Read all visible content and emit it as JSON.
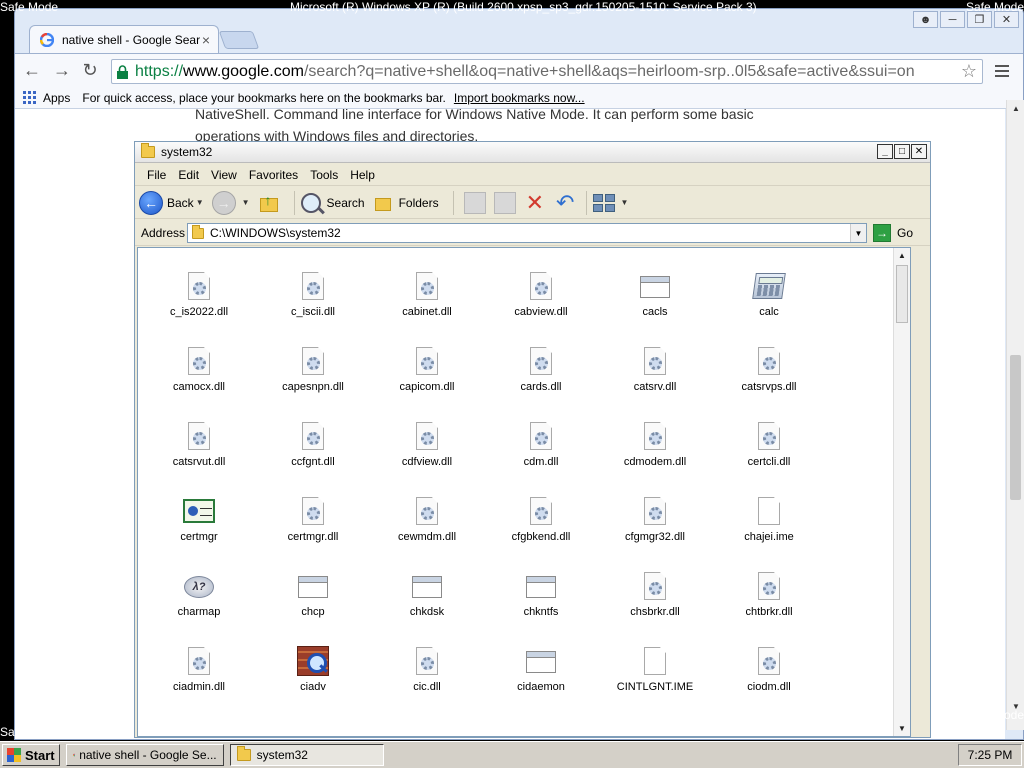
{
  "os": {
    "safe_mode_label": "Safe Mode",
    "top_title": "Microsoft (R) Windows XP (R) (Build 2600.xpsp_sp3_gdr.150205-1510: Service Pack 3)"
  },
  "chrome": {
    "tab_title": "native shell - Google Sear",
    "tab_close": "×",
    "url_scheme": "https://",
    "url_host": "www.google.com",
    "url_path": "/search?q=native+shell&oq=native+shell&aqs=heirloom-srp..0l5&safe=active&ssui=on",
    "bookmarks_apps": "Apps",
    "bookmarks_hint": "For quick access, place your bookmarks here on the bookmarks bar.",
    "bookmarks_import": "Import bookmarks now...",
    "page_text_line1": "NativeShell. Command line interface for Windows Native Mode. It can perform some basic",
    "page_text_line2": "operations with Windows files and directories."
  },
  "explorer": {
    "title": "system32",
    "menu": [
      "File",
      "Edit",
      "View",
      "Favorites",
      "Tools",
      "Help"
    ],
    "toolbar": {
      "back": "Back",
      "search": "Search",
      "folders": "Folders"
    },
    "address_label": "Address",
    "address_value": "C:\\WINDOWS\\system32",
    "go_label": "Go",
    "items": [
      {
        "name": "c_is2022.dll",
        "icon": "dll"
      },
      {
        "name": "c_iscii.dll",
        "icon": "dll"
      },
      {
        "name": "cabinet.dll",
        "icon": "dll"
      },
      {
        "name": "cabview.dll",
        "icon": "dll"
      },
      {
        "name": "cacls",
        "icon": "exe"
      },
      {
        "name": "calc",
        "icon": "calc"
      },
      {
        "name": "camocx.dll",
        "icon": "dll"
      },
      {
        "name": "capesnpn.dll",
        "icon": "dll"
      },
      {
        "name": "capicom.dll",
        "icon": "dll"
      },
      {
        "name": "cards.dll",
        "icon": "dll"
      },
      {
        "name": "catsrv.dll",
        "icon": "dll"
      },
      {
        "name": "catsrvps.dll",
        "icon": "dll"
      },
      {
        "name": "catsrvut.dll",
        "icon": "dll"
      },
      {
        "name": "ccfgnt.dll",
        "icon": "dll"
      },
      {
        "name": "cdfview.dll",
        "icon": "dll"
      },
      {
        "name": "cdm.dll",
        "icon": "dll"
      },
      {
        "name": "cdmodem.dll",
        "icon": "dll"
      },
      {
        "name": "certcli.dll",
        "icon": "dll"
      },
      {
        "name": "certmgr",
        "icon": "cert"
      },
      {
        "name": "certmgr.dll",
        "icon": "dll"
      },
      {
        "name": "cewmdm.dll",
        "icon": "dll"
      },
      {
        "name": "cfgbkend.dll",
        "icon": "dll"
      },
      {
        "name": "cfgmgr32.dll",
        "icon": "dll"
      },
      {
        "name": "chajei.ime",
        "icon": "blank"
      },
      {
        "name": "charmap",
        "icon": "charmap"
      },
      {
        "name": "chcp",
        "icon": "exe"
      },
      {
        "name": "chkdsk",
        "icon": "exe"
      },
      {
        "name": "chkntfs",
        "icon": "exe"
      },
      {
        "name": "chsbrkr.dll",
        "icon": "dll"
      },
      {
        "name": "chtbrkr.dll",
        "icon": "dll"
      },
      {
        "name": "ciadmin.dll",
        "icon": "dll"
      },
      {
        "name": "ciadv",
        "icon": "ciadv"
      },
      {
        "name": "cic.dll",
        "icon": "dll"
      },
      {
        "name": "cidaemon",
        "icon": "exe"
      },
      {
        "name": "CINTLGNT.IME",
        "icon": "blank"
      },
      {
        "name": "ciodm.dll",
        "icon": "dll"
      }
    ]
  },
  "taskbar": {
    "start": "Start",
    "task_chrome": "native shell - Google Se...",
    "task_explorer": "system32",
    "clock": "7:25 PM"
  }
}
